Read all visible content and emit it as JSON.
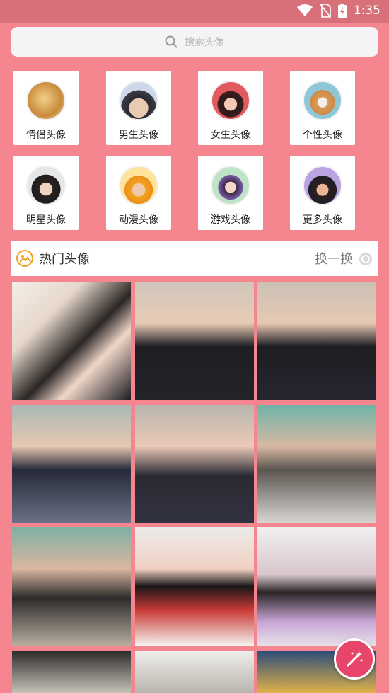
{
  "status_bar": {
    "time": "1:35"
  },
  "search": {
    "placeholder": "搜索头像"
  },
  "categories": [
    {
      "label": "情侣头像",
      "icon": "couple-avatar-icon"
    },
    {
      "label": "男生头像",
      "icon": "boy-avatar-icon"
    },
    {
      "label": "女生头像",
      "icon": "girl-avatar-icon"
    },
    {
      "label": "个性头像",
      "icon": "shiba-dog-avatar-icon"
    },
    {
      "label": "明星头像",
      "icon": "star-avatar-icon"
    },
    {
      "label": "动漫头像",
      "icon": "anime-avatar-icon"
    },
    {
      "label": "游戏头像",
      "icon": "game-avatar-icon"
    },
    {
      "label": "更多头像",
      "icon": "more-avatar-icon"
    }
  ],
  "hot": {
    "title": "热门头像",
    "refresh": "换一换"
  },
  "colors": {
    "background": "#f5858f",
    "accent": "#e8456a",
    "card": "#ffffff"
  }
}
